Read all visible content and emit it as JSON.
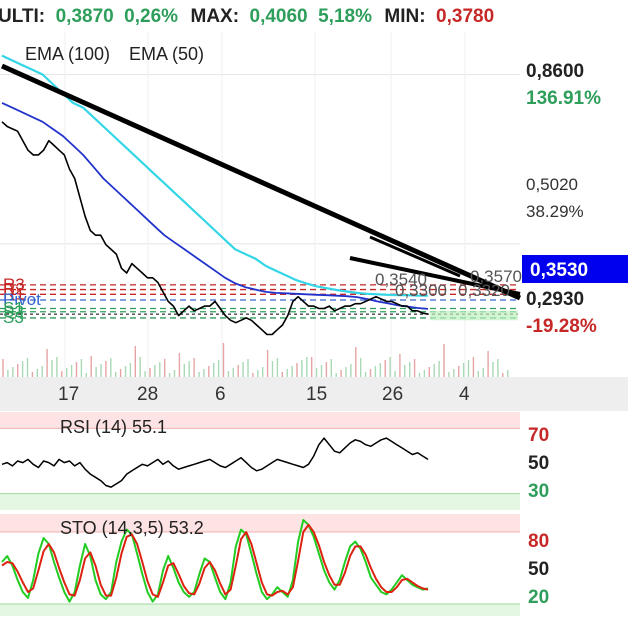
{
  "header": {
    "last_label": "ULTI:",
    "last_value": "0,3870",
    "last_change": "0,26%",
    "max_label": "MAX:",
    "max_value": "0,4060",
    "max_change": "5,18%",
    "min_label": "MIN:",
    "min_value": "0,3780"
  },
  "colors": {
    "up": "#2e9e5b",
    "down": "#c62828",
    "ema100": "#33d6e6",
    "ema50": "#2233cc",
    "price": "#000000",
    "stoch_k": "#22cc22",
    "stoch_d": "#dd2211",
    "current_box": "#0000ee",
    "overbought_zone": "#fde3e3",
    "oversold_zone": "#e3f7e3"
  },
  "chart_data": [
    {
      "type": "line",
      "title": "",
      "legend": [
        {
          "name": "EMA (100)",
          "color": "#33d6e6"
        },
        {
          "name": "EMA (50)",
          "color": "#2233cc"
        }
      ],
      "x_ticks": [
        "17",
        "28",
        "6",
        "15",
        "26",
        "4"
      ],
      "y_ticks": [
        {
          "value": 0.86,
          "label": "0,8600",
          "pct": "136.91%"
        },
        {
          "value": 0.502,
          "label": "0,5020",
          "pct": "38.29%"
        },
        {
          "value": 0.293,
          "label": "0,2930",
          "pct": "-19.28%"
        }
      ],
      "current_price": {
        "value": 0.353,
        "label": "0,3530"
      },
      "ylim": [
        0.22,
        0.95
      ],
      "pivot_levels": [
        {
          "name": "R3",
          "value": 0.415,
          "color": "#c62828"
        },
        {
          "name": "R2",
          "value": 0.405,
          "color": "#c62828"
        },
        {
          "name": "R1",
          "value": 0.395,
          "color": "#c62828"
        },
        {
          "name": "Pivot",
          "value": 0.383,
          "color": "#3366cc"
        },
        {
          "name": "S1",
          "value": 0.365,
          "color": "#2e9e5b"
        },
        {
          "name": "S2",
          "value": 0.358,
          "color": "#2e9e5b"
        },
        {
          "name": "S3",
          "value": 0.345,
          "color": "#2e9e5b"
        }
      ],
      "level_annotations": [
        "0,3570",
        "0,3540",
        "0,3300",
        "0,3320"
      ],
      "series": [
        {
          "name": "Price",
          "values": [
            0.76,
            0.75,
            0.745,
            0.74,
            0.72,
            0.7,
            0.69,
            0.69,
            0.7,
            0.72,
            0.71,
            0.7,
            0.69,
            0.66,
            0.64,
            0.6,
            0.56,
            0.53,
            0.52,
            0.52,
            0.5,
            0.49,
            0.48,
            0.45,
            0.44,
            0.46,
            0.45,
            0.44,
            0.43,
            0.43,
            0.42,
            0.4,
            0.38,
            0.37,
            0.35,
            0.36,
            0.37,
            0.36,
            0.365,
            0.37,
            0.37,
            0.38,
            0.365,
            0.35,
            0.34,
            0.335,
            0.34,
            0.345,
            0.34,
            0.33,
            0.32,
            0.31,
            0.31,
            0.32,
            0.33,
            0.35,
            0.38,
            0.39,
            0.38,
            0.37,
            0.37,
            0.365,
            0.365,
            0.37,
            0.36,
            0.365,
            0.37,
            0.37,
            0.375,
            0.375,
            0.38,
            0.385,
            0.39,
            0.385,
            0.38,
            0.38,
            0.375,
            0.37,
            0.37,
            0.36,
            0.36,
            0.355,
            0.353
          ]
        },
        {
          "name": "EMA (100)",
          "values": [
            0.9,
            0.89,
            0.88,
            0.87,
            0.86,
            0.84,
            0.82,
            0.8,
            0.79,
            0.77,
            0.75,
            0.73,
            0.71,
            0.69,
            0.67,
            0.65,
            0.63,
            0.61,
            0.59,
            0.57,
            0.55,
            0.53,
            0.51,
            0.49,
            0.48,
            0.47,
            0.455,
            0.445,
            0.435,
            0.425,
            0.418,
            0.412,
            0.408,
            0.404,
            0.401,
            0.398,
            0.396,
            0.395,
            0.394,
            0.393,
            0.393,
            0.392,
            0.392
          ]
        },
        {
          "name": "EMA (50)",
          "values": [
            0.8,
            0.79,
            0.78,
            0.77,
            0.76,
            0.745,
            0.73,
            0.71,
            0.69,
            0.665,
            0.64,
            0.62,
            0.6,
            0.58,
            0.56,
            0.54,
            0.52,
            0.505,
            0.49,
            0.475,
            0.46,
            0.445,
            0.43,
            0.418,
            0.41,
            0.405,
            0.4,
            0.398,
            0.397,
            0.396,
            0.395,
            0.394,
            0.393,
            0.392,
            0.391,
            0.389,
            0.385,
            0.38,
            0.376,
            0.372,
            0.369,
            0.366,
            0.364
          ]
        }
      ]
    },
    {
      "type": "line",
      "title": "RSI (14) 55.1",
      "y_ticks": [
        {
          "value": 70,
          "label": "70"
        },
        {
          "value": 50,
          "label": "50"
        },
        {
          "value": 30,
          "label": "30"
        }
      ],
      "ylim": [
        20,
        80
      ],
      "series": [
        {
          "name": "RSI",
          "values": [
            48,
            49,
            47,
            50,
            49,
            51,
            48,
            46,
            50,
            49,
            47,
            51,
            49,
            50,
            47,
            49,
            45,
            42,
            40,
            38,
            35,
            34,
            36,
            38,
            42,
            44,
            46,
            48,
            47,
            49,
            51,
            48,
            50,
            47,
            45,
            46,
            47,
            48,
            49,
            50,
            51,
            49,
            47,
            46,
            48,
            50,
            52,
            49,
            46,
            44,
            45,
            47,
            49,
            51,
            50,
            49,
            48,
            47,
            46,
            48,
            53,
            60,
            64,
            60,
            56,
            55,
            58,
            61,
            63,
            62,
            60,
            59,
            61,
            63,
            64,
            62,
            60,
            58,
            56,
            54,
            55,
            53,
            51
          ]
        }
      ]
    },
    {
      "type": "line",
      "title": "STO (14,3,5) 53.2",
      "y_ticks": [
        {
          "value": 80,
          "label": "80"
        },
        {
          "value": 50,
          "label": "50"
        },
        {
          "value": 20,
          "label": "20"
        }
      ],
      "ylim": [
        10,
        95
      ],
      "series": [
        {
          "name": "%K",
          "values": [
            55,
            60,
            52,
            40,
            30,
            25,
            40,
            62,
            75,
            70,
            55,
            42,
            30,
            22,
            30,
            52,
            70,
            60,
            40,
            28,
            24,
            30,
            55,
            72,
            82,
            78,
            62,
            45,
            30,
            22,
            28,
            48,
            60,
            50,
            38,
            30,
            26,
            30,
            45,
            58,
            55,
            42,
            30,
            24,
            38,
            68,
            82,
            78,
            62,
            45,
            30,
            24,
            28,
            34,
            30,
            26,
            40,
            72,
            90,
            86,
            76,
            62,
            48,
            38,
            32,
            40,
            55,
            68,
            72,
            66,
            55,
            42,
            36,
            30,
            28,
            32,
            38,
            44,
            40,
            36,
            34,
            32,
            33
          ]
        },
        {
          "name": "%D",
          "values": [
            52,
            55,
            54,
            47,
            38,
            30,
            33,
            48,
            64,
            70,
            63,
            50,
            38,
            28,
            27,
            40,
            58,
            63,
            52,
            36,
            27,
            27,
            42,
            62,
            76,
            78,
            70,
            55,
            39,
            28,
            26,
            38,
            52,
            54,
            45,
            35,
            29,
            28,
            37,
            50,
            55,
            48,
            37,
            28,
            32,
            52,
            74,
            80,
            70,
            54,
            38,
            28,
            27,
            30,
            31,
            28,
            34,
            56,
            80,
            86,
            80,
            69,
            55,
            44,
            36,
            36,
            46,
            60,
            68,
            68,
            61,
            50,
            41,
            34,
            30,
            30,
            34,
            40,
            41,
            38,
            35,
            33,
            32
          ]
        }
      ]
    }
  ]
}
